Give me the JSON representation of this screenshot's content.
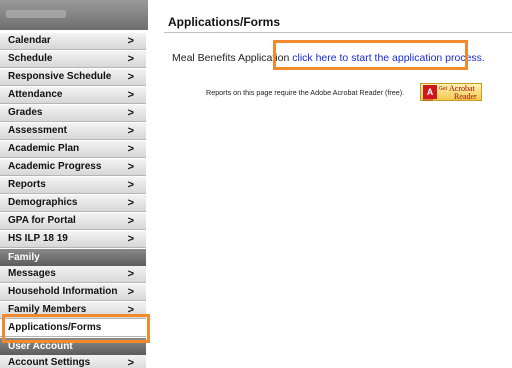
{
  "sidebar": {
    "items": [
      {
        "label": "Calendar",
        "chevron": ">"
      },
      {
        "label": "Schedule",
        "chevron": ">"
      },
      {
        "label": "Responsive Schedule",
        "chevron": ">"
      },
      {
        "label": "Attendance",
        "chevron": ">"
      },
      {
        "label": "Grades",
        "chevron": ">"
      },
      {
        "label": "Assessment",
        "chevron": ">"
      },
      {
        "label": "Academic Plan",
        "chevron": ">"
      },
      {
        "label": "Academic Progress",
        "chevron": ">"
      },
      {
        "label": "Reports",
        "chevron": ">"
      },
      {
        "label": "Demographics",
        "chevron": ">"
      },
      {
        "label": "GPA for Portal",
        "chevron": ">"
      },
      {
        "label": "HS ILP 18 19",
        "chevron": ">"
      }
    ],
    "family_header": "Family",
    "family_items": [
      {
        "label": "Messages",
        "chevron": ">"
      },
      {
        "label": "Household Information",
        "chevron": ">"
      },
      {
        "label": "Family Members",
        "chevron": ">"
      },
      {
        "label": "Applications/Forms",
        "chevron": ""
      }
    ],
    "user_header": "User Account",
    "user_items": [
      {
        "label": "Account Settings",
        "chevron": ">"
      }
    ]
  },
  "main": {
    "title": "Applications/Forms",
    "form_label": "Meal Benefits Application",
    "form_link": "click here to start the application process.",
    "reports_note": "Reports on this page require the Adobe Acrobat Reader (free).",
    "adobe": {
      "logo": "A",
      "get": "Get",
      "acrobat": "Acrobat",
      "reader": "Reader",
      "small": "Adobe"
    }
  },
  "colors": {
    "highlight": "#f08a2c",
    "link": "#1a2bd6"
  }
}
